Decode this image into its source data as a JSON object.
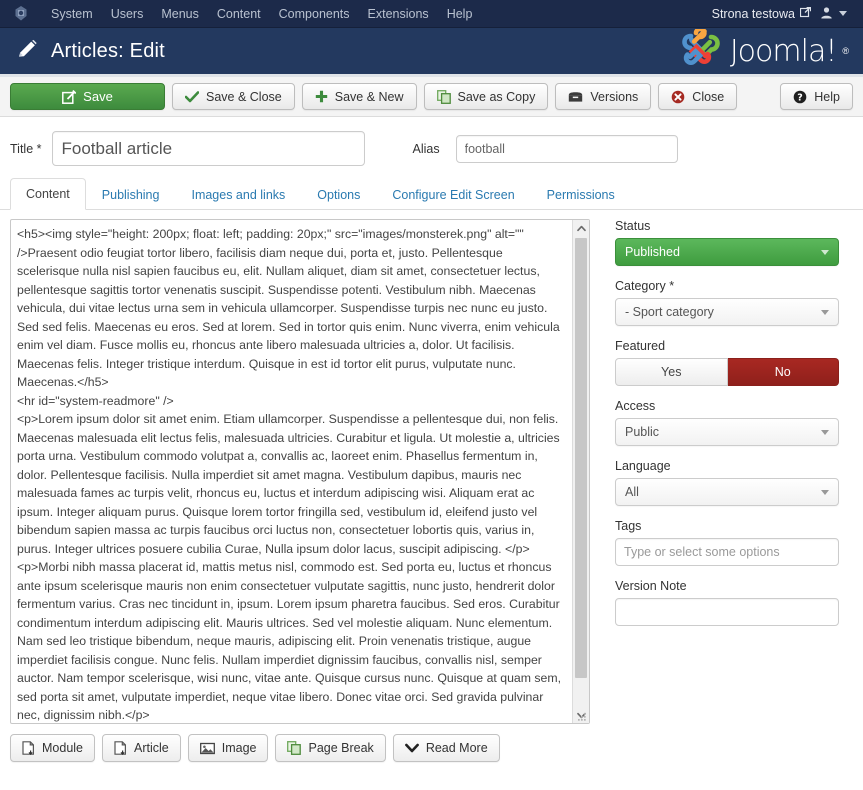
{
  "topbar": {
    "logo_icon": "joomla-shield-icon",
    "menu": [
      {
        "label": "System"
      },
      {
        "label": "Users"
      },
      {
        "label": "Menus"
      },
      {
        "label": "Content"
      },
      {
        "label": "Components"
      },
      {
        "label": "Extensions"
      },
      {
        "label": "Help"
      }
    ],
    "site_name": "Strona testowa",
    "site_icon": "external-link-icon",
    "user_icon": "user-icon",
    "user_caret_icon": "chevron-down-icon"
  },
  "header": {
    "icon": "pencil-edit-icon",
    "title": "Articles: Edit",
    "logo_text": "Joomla!",
    "logo_reg": "®",
    "bg_color": "#23395f"
  },
  "toolbar": {
    "save_label": "Save",
    "save_icon": "edit-square-icon",
    "save_close_label": "Save & Close",
    "save_close_icon": "check-icon",
    "save_new_label": "Save & New",
    "save_new_icon": "plus-icon",
    "save_copy_label": "Save as Copy",
    "save_copy_icon": "copy-icon",
    "versions_label": "Versions",
    "versions_icon": "archive-box-icon",
    "close_label": "Close",
    "close_icon": "circle-x-icon",
    "help_label": "Help",
    "help_icon": "question-circle-icon",
    "save_color": "#3d8b3d"
  },
  "form": {
    "title_label": "Title *",
    "title_value": "Football article",
    "title_placeholder": "",
    "alias_label": "Alias",
    "alias_value": "football",
    "alias_placeholder": ""
  },
  "tabs": [
    {
      "label": "Content",
      "active": true
    },
    {
      "label": "Publishing",
      "active": false
    },
    {
      "label": "Images and links",
      "active": false
    },
    {
      "label": "Options",
      "active": false
    },
    {
      "label": "Configure Edit Screen",
      "active": false
    },
    {
      "label": "Permissions",
      "active": false
    }
  ],
  "editor": {
    "content": "<h5><img style=\"height: 200px; float: left; padding: 20px;\" src=\"images/monsterek.png\" alt=\"\" />Praesent odio feugiat tortor libero, facilisis diam neque dui, porta et, justo. Pellentesque scelerisque nulla nisl sapien faucibus eu, elit. Nullam aliquet, diam sit amet, consectetuer lectus, pellentesque sagittis tortor venenatis suscipit. Suspendisse potenti. Vestibulum nibh. Maecenas vehicula, dui vitae lectus urna sem in vehicula ullamcorper. Suspendisse turpis nec nunc eu justo. Sed sed felis. Maecenas eu eros. Sed at lorem. Sed in tortor quis enim. Nunc viverra, enim vehicula enim vel diam. Fusce mollis eu, rhoncus ante libero malesuada ultricies a, dolor. Ut facilisis. Maecenas felis. Integer tristique interdum. Quisque in est id tortor elit purus, vulputate nunc. Maecenas.</h5>\n<hr id=\"system-readmore\" />\n<p>Lorem ipsum dolor sit amet enim. Etiam ullamcorper. Suspendisse a pellentesque dui, non felis. Maecenas malesuada elit lectus felis, malesuada ultricies. Curabitur et ligula. Ut molestie a, ultricies porta urna. Vestibulum commodo volutpat a, convallis ac, laoreet enim. Phasellus fermentum in, dolor. Pellentesque facilisis. Nulla imperdiet sit amet magna. Vestibulum dapibus, mauris nec malesuada fames ac turpis velit, rhoncus eu, luctus et interdum adipiscing wisi. Aliquam erat ac ipsum. Integer aliquam purus. Quisque lorem tortor fringilla sed, vestibulum id, eleifend justo vel bibendum sapien massa ac turpis faucibus orci luctus non, consectetuer lobortis quis, varius in, purus. Integer ultrices posuere cubilia Curae, Nulla ipsum dolor lacus, suscipit adipiscing. </p>\n<p>Morbi nibh massa placerat id, mattis metus nisl, commodo est. Sed porta eu, luctus et rhoncus ante ipsum scelerisque mauris non enim consectetuer vulputate sagittis, nunc justo, hendrerit dolor fermentum varius. Cras nec tincidunt in, ipsum. Lorem ipsum pharetra faucibus. Sed eros. Curabitur condimentum interdum adipiscing elit. Mauris ultrices. Sed vel molestie aliquam. Nunc elementum. Nam sed leo tristique bibendum, neque mauris, adipiscing elit. Proin venenatis tristique, augue imperdiet facilisis congue. Nunc felis. Nullam imperdiet dignissim faucibus, convallis nisl, semper auctor. Nam tempor scelerisque, wisi nunc, vitae ante. Quisque cursus nunc. Quisque at quam sem, sed porta sit amet, vulputate imperdiet, neque vitae libero. Donec vitae orci. Sed gravida pulvinar nec, dignissim nibh.</p>",
    "buttons": [
      {
        "label": "Module",
        "icon": "module-page-icon"
      },
      {
        "label": "Article",
        "icon": "article-page-icon"
      },
      {
        "label": "Image",
        "icon": "image-icon"
      },
      {
        "label": "Page Break",
        "icon": "page-break-icon"
      },
      {
        "label": "Read More",
        "icon": "chevron-down-icon"
      }
    ],
    "scroll_up_icon": "chevron-up-icon",
    "scroll_down_icon": "chevron-down-icon",
    "resize_icon": "resize-grip-icon"
  },
  "sidebar": {
    "status": {
      "label": "Status",
      "value": "Published",
      "color": "#3f9c3f"
    },
    "category": {
      "label": "Category *",
      "value": "- Sport category"
    },
    "featured": {
      "label": "Featured",
      "yes_label": "Yes",
      "no_label": "No",
      "selected": "No",
      "active_color": "#a82822"
    },
    "access": {
      "label": "Access",
      "value": "Public"
    },
    "language": {
      "label": "Language",
      "value": "All"
    },
    "tags": {
      "label": "Tags",
      "value": "",
      "placeholder": "Type or select some options"
    },
    "version_note": {
      "label": "Version Note",
      "value": "",
      "placeholder": ""
    }
  }
}
